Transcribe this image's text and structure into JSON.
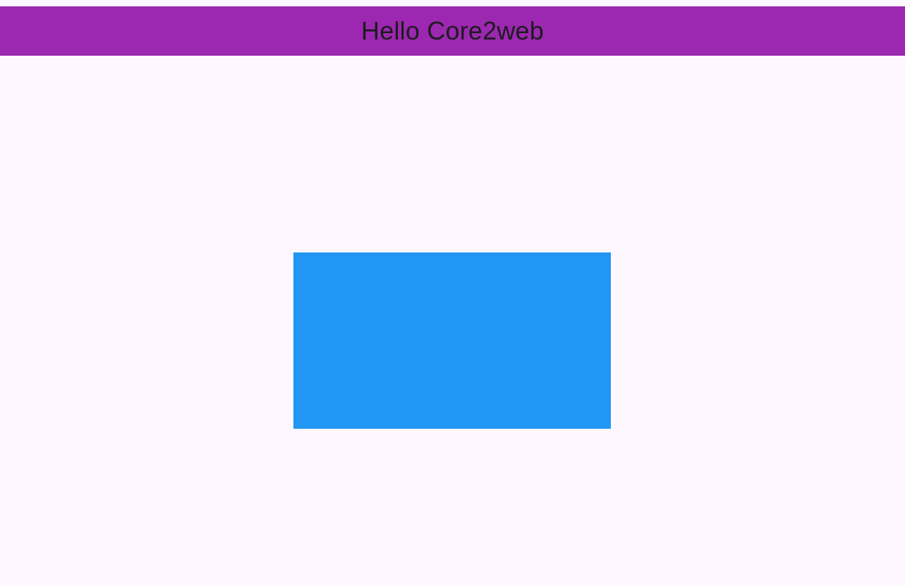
{
  "app_bar": {
    "title": "Hello Core2web",
    "background_color": "#9C27B0",
    "title_color": "#1D1B20"
  },
  "page": {
    "background_color": "#FEF7FF"
  },
  "container": {
    "color": "#2196F3"
  }
}
